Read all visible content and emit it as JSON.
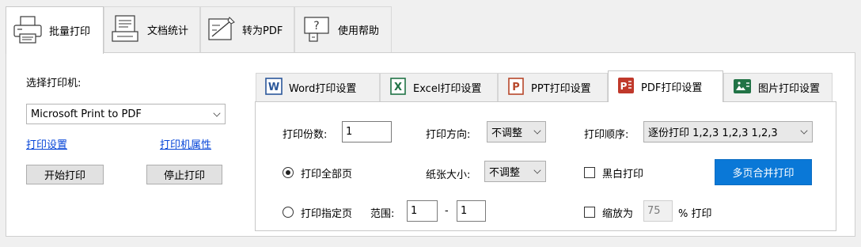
{
  "top_tabs": [
    {
      "label": "批量打印",
      "icon": "printer-icon",
      "active": true
    },
    {
      "label": "文档统计",
      "icon": "document-stats-icon",
      "active": false
    },
    {
      "label": "转为PDF",
      "icon": "convert-pdf-icon",
      "active": false
    },
    {
      "label": "使用帮助",
      "icon": "help-icon",
      "active": false
    }
  ],
  "left": {
    "select_printer_label": "选择打印机:",
    "printer_value": "Microsoft Print to PDF",
    "print_settings_link": "打印设置",
    "printer_properties_link": "打印机属性",
    "start_button": "开始打印",
    "stop_button": "停止打印"
  },
  "inner_tabs": [
    {
      "label": "Word打印设置",
      "icon": "word-icon",
      "active": false
    },
    {
      "label": "Excel打印设置",
      "icon": "excel-icon",
      "active": false
    },
    {
      "label": "PPT打印设置",
      "icon": "ppt-icon",
      "active": false
    },
    {
      "label": "PDF打印设置",
      "icon": "pdf-icon",
      "active": true
    },
    {
      "label": "图片打印设置",
      "icon": "image-icon",
      "active": false
    }
  ],
  "pdf_settings": {
    "copies_label": "打印份数:",
    "copies_value": "1",
    "direction_label": "打印方向:",
    "direction_value": "不调整",
    "order_label": "打印顺序:",
    "order_value": "逐份打印 1,2,3 1,2,3 1,2,3",
    "print_all_label": "打印全部页",
    "paper_size_label": "纸张大小:",
    "paper_size_value": "不调整",
    "bw_label": "黑白打印",
    "merge_button": "多页合并打印",
    "print_range_label": "打印指定页",
    "range_label": "范围:",
    "range_from": "1",
    "range_dash": "-",
    "range_to": "1",
    "scale_label": "缩放为",
    "scale_value": "75",
    "scale_suffix": "% 打印"
  },
  "colors": {
    "accent_blue": "#0a78d7",
    "link_blue": "#0645d8",
    "word_blue": "#2b579a",
    "excel_green": "#217346",
    "ppt_red": "#b7472a",
    "pdf_red": "#c0392b"
  }
}
